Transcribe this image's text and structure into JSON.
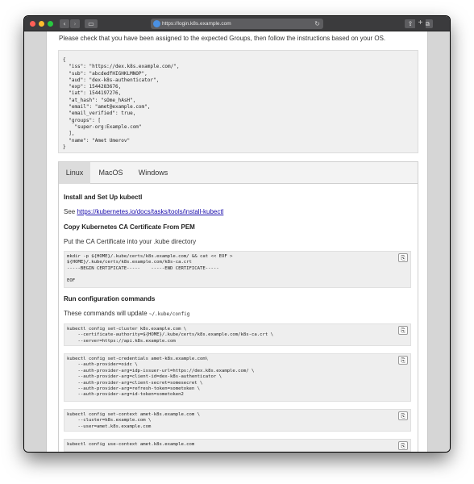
{
  "browser": {
    "url": "https://login.k8s.example.com",
    "back_icon": "‹",
    "forward_icon": "›",
    "sidebar_icon": "▭",
    "reload_icon": "↻",
    "share_icon": "⇪",
    "tabs_icon": "⧉",
    "new_tab_icon": "+"
  },
  "page": {
    "intro": "Please check that you have been assigned to the expected Groups, then follow the instructions based on your OS.",
    "token_json": "{\n  \"iss\": \"https://dex.k8s.example.com/\",\n  \"sub\": \"abcdedfHIGHKLMNOP\",\n  \"aud\": \"dex-k8s-authenticator\",\n  \"exp\": 1544283676,\n  \"iat\": 1544197276,\n  \"at_hash\": \"sOme_hAsH\",\n  \"email\": \"amet@example.com\",\n  \"email_verified\": true,\n  \"groups\": [\n    \"super-org:Example.com\"\n  ],\n  \"name\": \"Amet Umerov\"\n}",
    "tabs": [
      "Linux",
      "MacOS",
      "Windows"
    ],
    "sections": {
      "install_heading": "Install and Set Up kubectl",
      "see_label": "See ",
      "install_link": "https://kubernetes.io/docs/tasks/tools/install-kubectl",
      "ca_heading": "Copy Kubernetes CA Certificate From PEM",
      "ca_text": "Put the CA Certificate into your .kube directory",
      "ca_code": "mkdir -p ${HOME}/.kube/certs/k8s.example.com/ && cat << EOF >\n${HOME}/.kube/certs/k8s.example.com/k8s-ca.crt\n-----BEGIN CERTIFICATE-----    -----END CERTIFICATE-----\n\nEOF",
      "config_heading": "Run configuration commands",
      "config_text": "These commands will update ",
      "config_path": "~/.kube/config",
      "code_cluster": "kubectl config set-cluster k8s.example.com \\\n    --certificate-authority=${HOME}/.kube/certs/k8s.example.com/k8s-ca.crt \\\n    --server=https://api.k8s.example.com",
      "code_credentials": "kubectl config set-credentials amet-k8s.example.com\\\n    --auth-provider=oidc \\\n    --auth-provider-arg=idp-issuer-url=https://dex.k8s.example.com/ \\\n    --auth-provider-arg=client-id=dex-k8s-authenticator \\\n    --auth-provider-arg=client-secret=somesecret \\\n    --auth-provider-arg=refresh-token=sometoken \\\n    --auth-provider-arg=id-token=sometoken2",
      "code_context": "kubectl config set-context amet-k8s.example.com \\\n    --cluster=k8s.example.com \\\n    --user=amet.k8s.example.com",
      "code_use": "kubectl config use-context amet.k8s.example.com"
    },
    "copy_icon": "⎘"
  }
}
